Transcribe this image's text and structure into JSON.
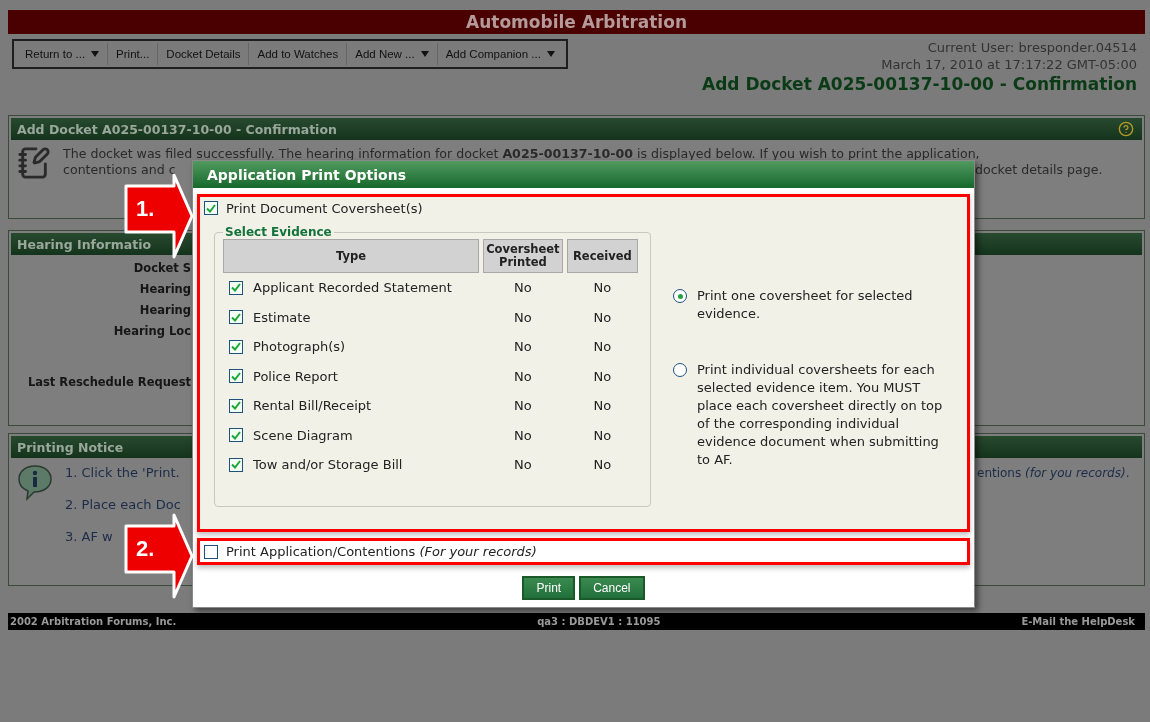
{
  "header": {
    "title": "Automobile Arbitration"
  },
  "toolbar": [
    {
      "label": "Return to ...",
      "dropdown": true
    },
    {
      "label": "Print...",
      "dropdown": false
    },
    {
      "label": "Docket Details",
      "dropdown": false
    },
    {
      "label": "Add to Watches",
      "dropdown": false
    },
    {
      "label": "Add New ...",
      "dropdown": true
    },
    {
      "label": "Add Companion ...",
      "dropdown": true
    }
  ],
  "user_info": {
    "current_user": "Current User: bresponder.04514",
    "timestamp": "March 17, 2010 at 17:17:22 GMT-05:00",
    "page_title": "Add Docket A025-00137-10-00 - Confirmation"
  },
  "confirmation_panel": {
    "title": "Add Docket A025-00137-10-00 - Confirmation",
    "message_line_1": "The docket was filed successfully. The hearing information for docket **A025-00137-10-00** is displayed below. If you wish to print the application,",
    "message_line_2_left": "contentions and c",
    "message_line_2_right": "docket details page."
  },
  "hearing_panel": {
    "title": "Hearing Informatio",
    "labels": [
      "Docket S",
      "Hearing",
      "Hearing",
      "Hearing Loc",
      "Last Reschedule Request"
    ]
  },
  "printing_notice": {
    "title": "Printing Notice",
    "steps": [
      "1. Click the 'Print.",
      "2. Place each Doc",
      "3. AF w"
    ],
    "step_1_right": "entions *(for you records)*."
  },
  "footer": {
    "left": "2002 Arbitration Forums, Inc.",
    "center": "qa3 : DBDEV1 : 11095",
    "right": "E-Mail the HelpDesk"
  },
  "dialog": {
    "title": "Application Print Options",
    "coversheet_option": {
      "label": "Print Document Coversheet(s)",
      "checked": true
    },
    "evidence": {
      "legend": "Select Evidence",
      "columns": [
        "Type",
        "Coversheet Printed",
        "Received"
      ],
      "rows": [
        {
          "type": "Applicant Recorded Statement",
          "checked": true,
          "printed": "No",
          "received": "No"
        },
        {
          "type": "Estimate",
          "checked": true,
          "printed": "No",
          "received": "No"
        },
        {
          "type": "Photograph(s)",
          "checked": true,
          "printed": "No",
          "received": "No"
        },
        {
          "type": "Police Report",
          "checked": true,
          "printed": "No",
          "received": "No"
        },
        {
          "type": "Rental Bill/Receipt",
          "checked": true,
          "printed": "No",
          "received": "No"
        },
        {
          "type": "Scene Diagram",
          "checked": true,
          "printed": "No",
          "received": "No"
        },
        {
          "type": "Tow and/or Storage Bill",
          "checked": true,
          "printed": "No",
          "received": "No"
        }
      ]
    },
    "coversheet_modes": [
      {
        "label": "Print one coversheet for selected evidence.",
        "selected": true
      },
      {
        "label": "Print individual coversheets for each selected evidence item. You MUST place each coversheet directly on top of the corresponding individual evidence document when submitting to AF.",
        "selected": false
      }
    ],
    "application_option": {
      "label": "Print Application/Contentions *(For your records)*",
      "checked": false
    },
    "buttons": [
      "Print",
      "Cancel"
    ]
  },
  "annotations": [
    {
      "label": "1."
    },
    {
      "label": "2."
    }
  ]
}
